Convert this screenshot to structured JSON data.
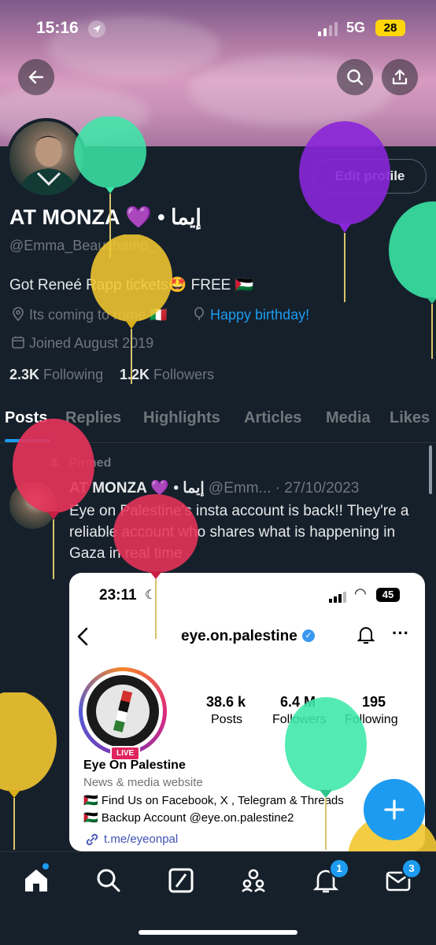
{
  "status_bar": {
    "time": "15:16",
    "network": "5G",
    "battery": "28"
  },
  "profile": {
    "name": "AT MONZA 💜 • إيما",
    "handle": "@Emma_Beauchamp_",
    "edit_label": "Edit profile",
    "bio": "Got Reneé Rapp tickets🤩 FREE 🇵🇸",
    "location": "Its coming to rome 🇮🇹",
    "website": "Happy birthday!",
    "joined": "Joined August 2019",
    "following_count": "2.3K",
    "following_label": "Following",
    "followers_count": "1.2K",
    "followers_label": "Followers"
  },
  "tabs": [
    "Posts",
    "Replies",
    "Highlights",
    "Articles",
    "Media",
    "Likes"
  ],
  "pinned_post": {
    "pinned_label": "Pinned",
    "author": "AT MONZA 💜 • إيما",
    "handle": "@Emm...",
    "date": "· 27/10/2023",
    "text": "Eye on Palestine's insta account is back!! They're a reliable account who shares what is happening in Gaza in real time"
  },
  "embedded": {
    "time": "23:11",
    "battery": "45",
    "username": "eye.on.palestine",
    "posts_count": "38.6 k",
    "posts_label": "Posts",
    "followers_count": "6.4 M",
    "followers_label": "Followers",
    "following_count": "195",
    "following_label": "Following",
    "live_label": "LIVE",
    "display_name": "Eye On Palestine",
    "category": "News & media website",
    "line1": "🇵🇸 Find Us on Facebook, X , Telegram & Threads",
    "line2": "🇵🇸 Backup Account @eye.on.palestine2",
    "link": "t.me/eyeonpal"
  },
  "nav": {
    "notifications_badge": "1",
    "messages_badge": "3"
  },
  "colors": {
    "accent": "#1d9bf0",
    "background": "#15202b",
    "muted": "#71767b"
  }
}
